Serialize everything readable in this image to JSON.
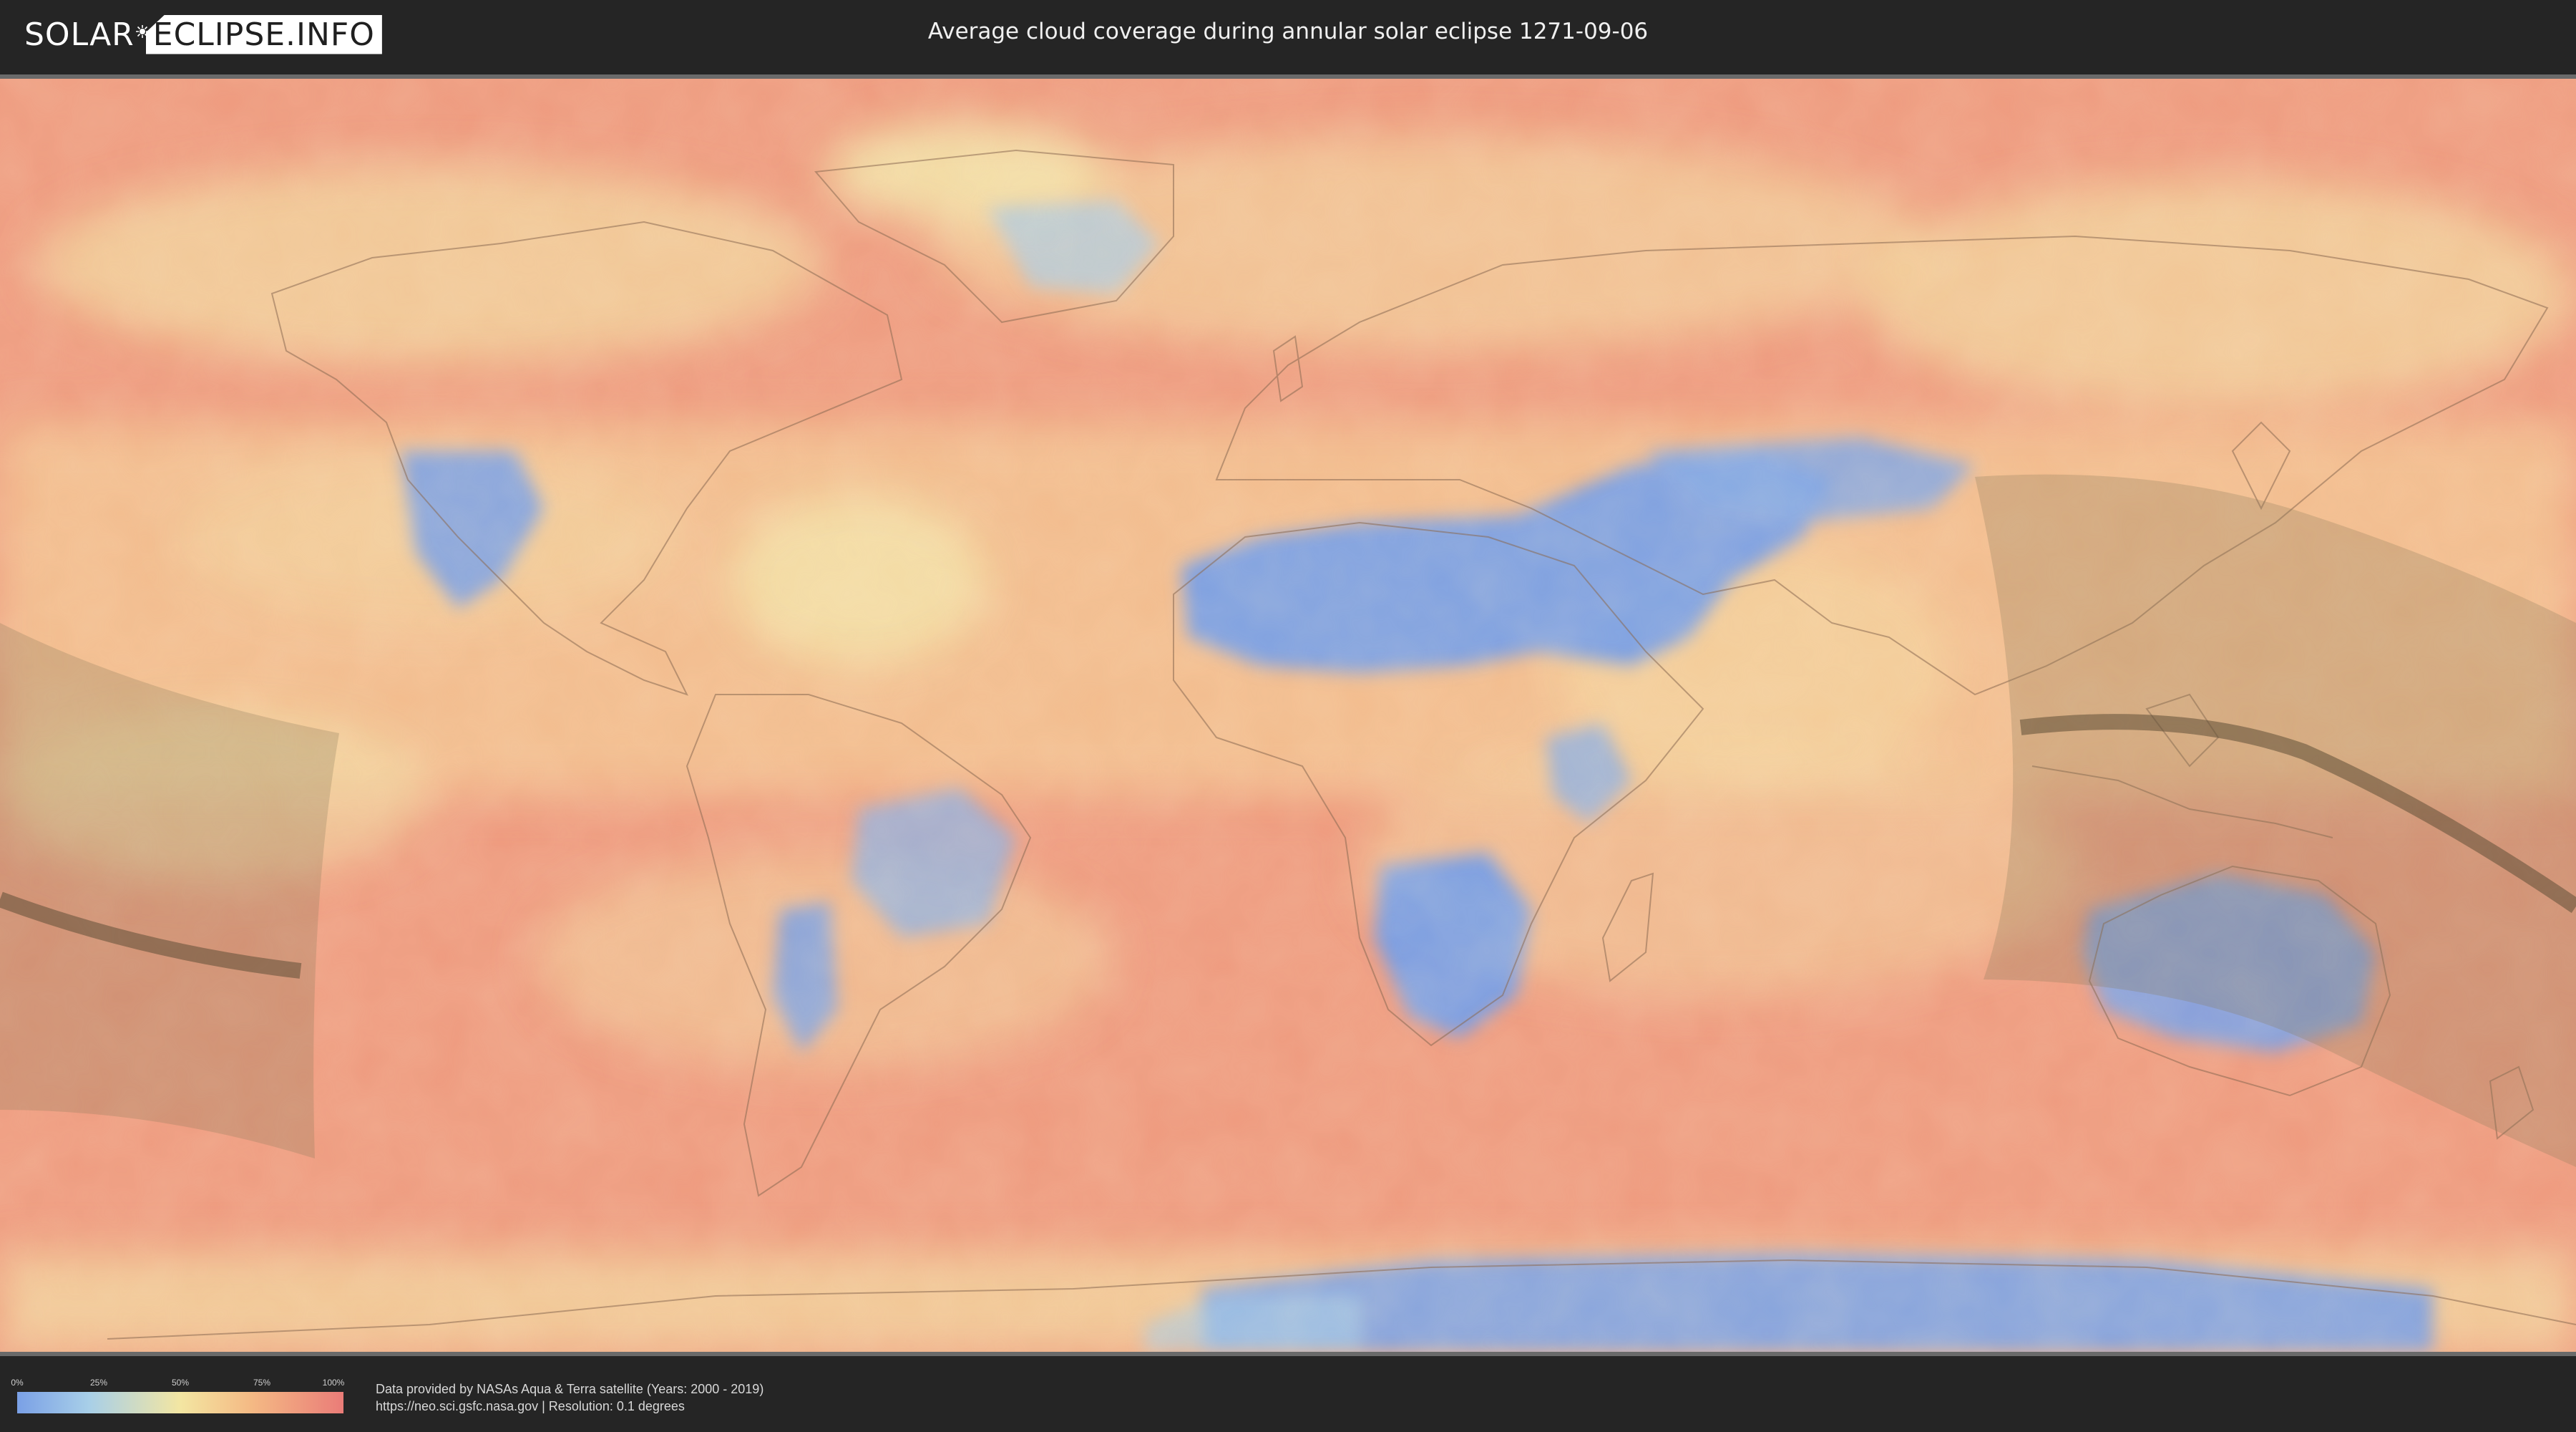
{
  "header": {
    "logo_left": "SOLAR",
    "logo_right": "ECLIPSE.INFO",
    "title": "Average cloud coverage during annular solar eclipse 1271-09-06"
  },
  "legend": {
    "ticks": [
      "0%",
      "25%",
      "50%",
      "75%",
      "100%"
    ],
    "colors": [
      "#7aa0e6",
      "#a8cfe8",
      "#f3e6a2",
      "#f4b984",
      "#ea7c78"
    ]
  },
  "credits": {
    "line1": "Data provided by NASAs Aqua & Terra satellite (Years: 2000 - 2019)",
    "line2": "https://neo.sci.gsfc.nasa.gov | Resolution: 0.1 degrees"
  },
  "map": {
    "colors": {
      "ocean_cloudy": "#ef9c80",
      "moderate": "#f3d8a0",
      "clear": "#7aa0e6",
      "eclipse_shadow": "#8a7a5a",
      "central_line": "#5e4e36"
    }
  }
}
